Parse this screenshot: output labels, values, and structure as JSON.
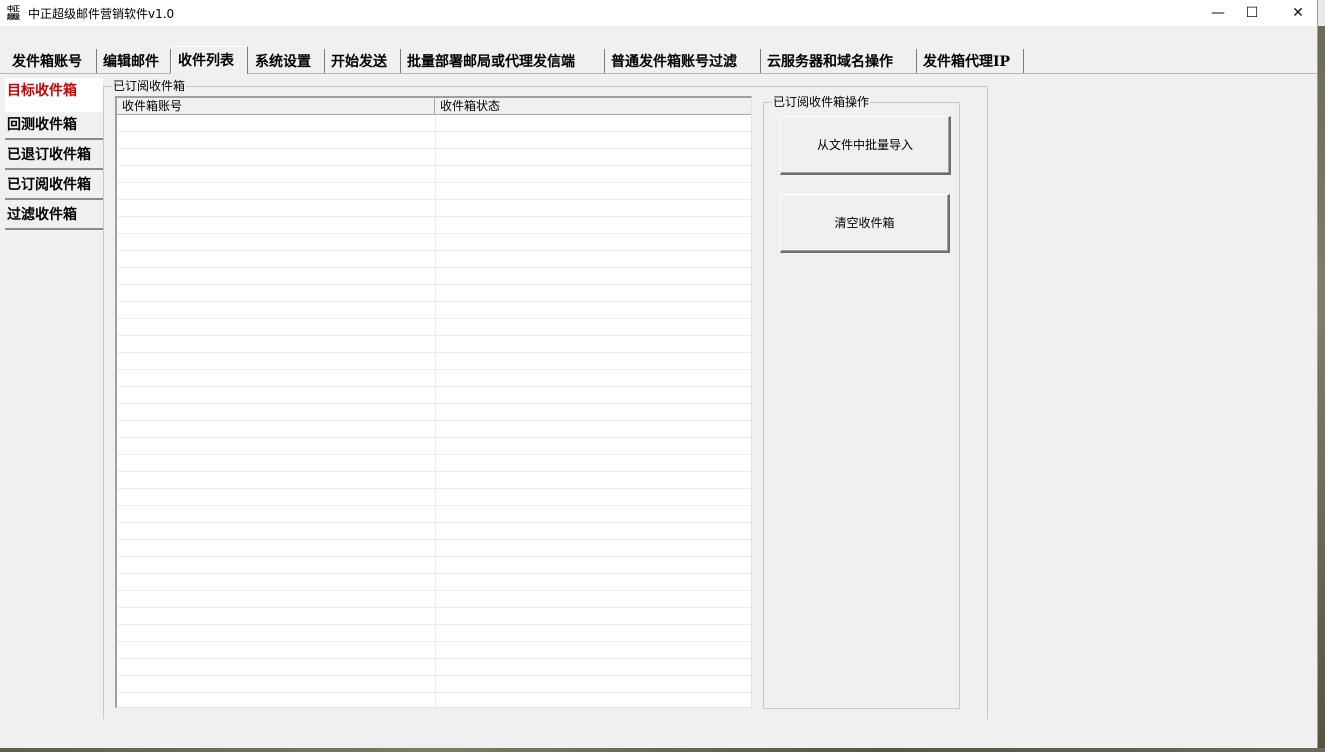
{
  "window": {
    "title": "中正超级邮件营销软件v1.0",
    "icon_text": "中正超级",
    "controls": {
      "minimize": "—",
      "maximize": "☐",
      "close": "✕"
    }
  },
  "tabs": [
    {
      "label": "发件箱账号",
      "active": false
    },
    {
      "label": "编辑邮件",
      "active": false
    },
    {
      "label": "收件列表",
      "active": true
    },
    {
      "label": "系统设置",
      "active": false
    },
    {
      "label": "开始发送",
      "active": false
    },
    {
      "label": "批量部署邮局或代理发信端",
      "active": false
    },
    {
      "label": "普通发件箱账号过滤",
      "active": false
    },
    {
      "label": "云服务器和域名操作",
      "active": false
    },
    {
      "label": "发件箱代理IP",
      "active": false
    }
  ],
  "side_tabs": [
    {
      "label": "目标收件箱",
      "active": true
    },
    {
      "label": "回测收件箱",
      "active": false
    },
    {
      "label": "已退订收件箱",
      "active": false
    },
    {
      "label": "已订阅收件箱",
      "active": false
    },
    {
      "label": "过滤收件箱",
      "active": false
    }
  ],
  "main_group": {
    "label": "已订阅收件箱",
    "list": {
      "columns": [
        "收件箱账号",
        "收件箱状态"
      ],
      "rows": []
    }
  },
  "ops_group": {
    "label": "已订阅收件箱操作",
    "import_button": "从文件中批量导入",
    "clear_button": "清空收件箱"
  },
  "colors": {
    "active_side_tab_text": "#cc0000",
    "window_bg": "#f0f0f0"
  }
}
